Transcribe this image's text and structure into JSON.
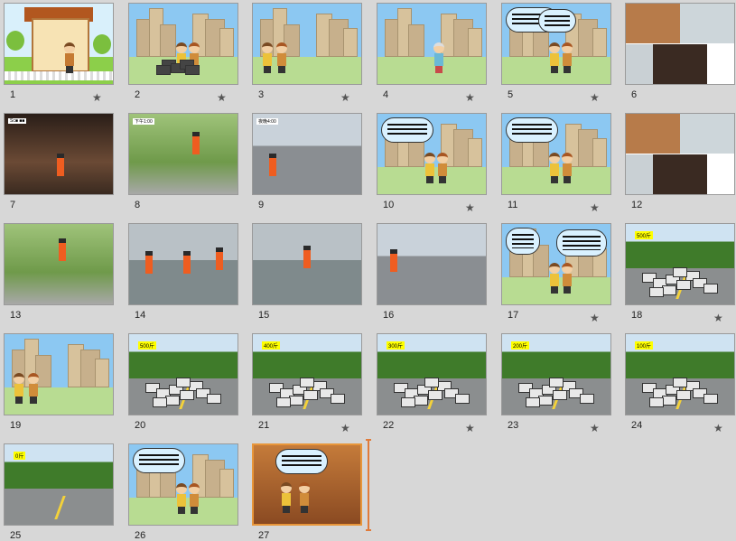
{
  "slides": [
    {
      "number": "1",
      "scene": "house",
      "star": true
    },
    {
      "number": "2",
      "scene": "city-trash",
      "star": true
    },
    {
      "number": "3",
      "scene": "city-kids",
      "star": true
    },
    {
      "number": "4",
      "scene": "city-grandma",
      "star": true
    },
    {
      "number": "5",
      "scene": "city-talk",
      "star": true
    },
    {
      "number": "6",
      "scene": "photo-collage",
      "star": false
    },
    {
      "number": "7",
      "scene": "photo-night",
      "star": false,
      "badge": "Sc■ ■■"
    },
    {
      "number": "8",
      "scene": "photo-worker",
      "star": false,
      "badge": "下午1:00"
    },
    {
      "number": "9",
      "scene": "photo-street",
      "star": false,
      "badge": "夜晚4:00"
    },
    {
      "number": "10",
      "scene": "city-talk",
      "star": true
    },
    {
      "number": "11",
      "scene": "city-talk",
      "star": true
    },
    {
      "number": "12",
      "scene": "photo-collage",
      "star": false
    },
    {
      "number": "13",
      "scene": "photo-smile",
      "star": false
    },
    {
      "number": "14",
      "scene": "photo-snow",
      "star": false
    },
    {
      "number": "15",
      "scene": "photo-wet",
      "star": false
    },
    {
      "number": "16",
      "scene": "photo-firecrackers",
      "star": false
    },
    {
      "number": "17",
      "scene": "city-talk-2",
      "star": true
    },
    {
      "number": "18",
      "scene": "road-trash",
      "star": true,
      "tag": "500斤"
    },
    {
      "number": "19",
      "scene": "city-kids",
      "star": false
    },
    {
      "number": "20",
      "scene": "road-trash",
      "star": false,
      "tag": "500斤"
    },
    {
      "number": "21",
      "scene": "road-trash",
      "star": true,
      "tag": "400斤"
    },
    {
      "number": "22",
      "scene": "road-trash",
      "star": true,
      "tag": "300斤"
    },
    {
      "number": "23",
      "scene": "road-trash",
      "star": true,
      "tag": "200斤"
    },
    {
      "number": "24",
      "scene": "road-trash",
      "star": true,
      "tag": "100斤"
    },
    {
      "number": "25",
      "scene": "road-empty",
      "star": false,
      "tag": "0斤"
    },
    {
      "number": "26",
      "scene": "city-talk",
      "star": false
    },
    {
      "number": "27",
      "scene": "room-talk",
      "star": false,
      "selected": true
    }
  ]
}
